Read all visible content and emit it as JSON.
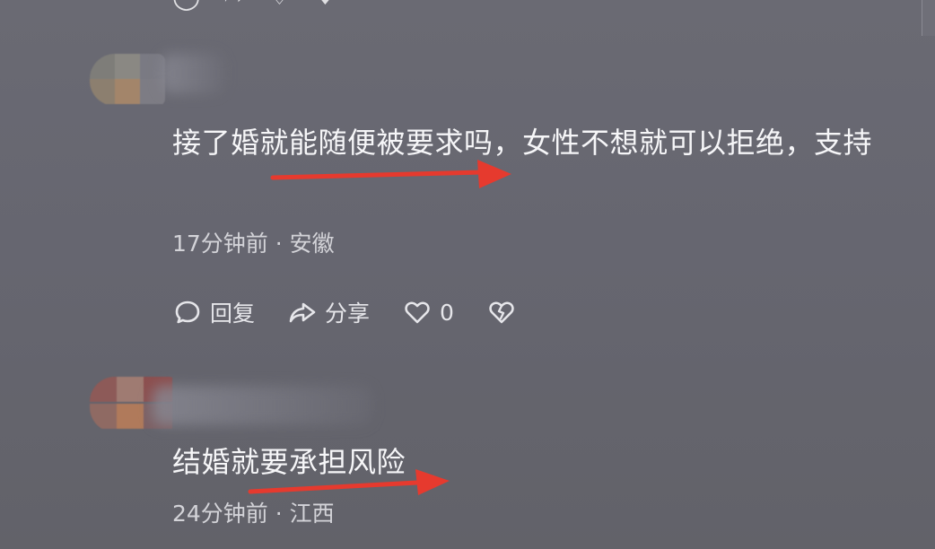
{
  "top_actions": [
    {
      "icon": "reply-icon",
      "label": "回复"
    },
    {
      "icon": "share-icon",
      "label": "分享"
    },
    {
      "icon": "like-icon",
      "label": "0"
    },
    {
      "icon": "dislike-icon",
      "label": ""
    }
  ],
  "comments": [
    {
      "text": "接了婚就能随便被要求吗，女性不想就可以拒绝，支持",
      "time": "17分钟前",
      "location": "安徽",
      "actions": {
        "reply": "回复",
        "share": "分享",
        "likes": "0"
      }
    },
    {
      "text": "结婚就要承担风险",
      "time": "24分钟前",
      "location": "江西"
    }
  ],
  "colors": {
    "background": "#66666f",
    "text": "#f6f6f8",
    "meta": "#d3d3d8",
    "arrow": "#e63a2e"
  }
}
